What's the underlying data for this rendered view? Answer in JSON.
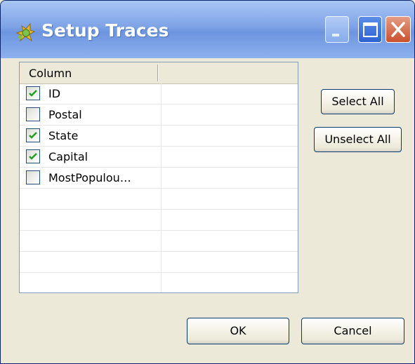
{
  "window": {
    "title": "Setup Traces"
  },
  "table": {
    "column_header": "Column",
    "rows": [
      {
        "label": "ID",
        "checked": true
      },
      {
        "label": "Postal",
        "checked": false
      },
      {
        "label": "State",
        "checked": true
      },
      {
        "label": "Capital",
        "checked": true
      },
      {
        "label": "MostPopulou…",
        "checked": false
      }
    ]
  },
  "buttons": {
    "select_all": "Select All",
    "unselect_all": "Unselect All",
    "ok": "OK",
    "cancel": "Cancel"
  },
  "colors": {
    "titlebar": "#7ea3e6",
    "checkmark": "#21a121",
    "dialog_bg": "#ece9d8"
  }
}
